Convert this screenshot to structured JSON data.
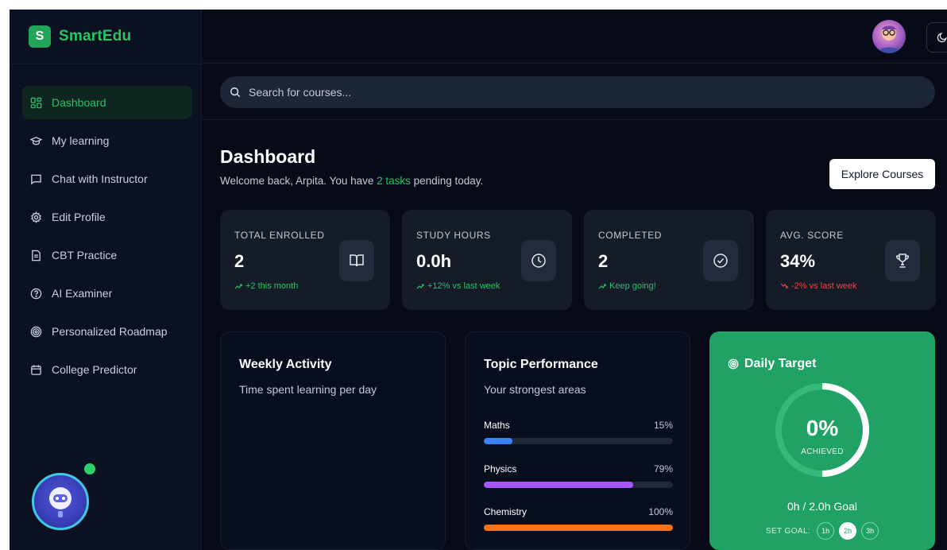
{
  "brand": {
    "logo_letter": "S",
    "name": "SmartEdu",
    "color": "#27c46a"
  },
  "sidebar": {
    "items": [
      {
        "label": "Dashboard",
        "icon": "dashboard-grid-icon",
        "active": true
      },
      {
        "label": "My learning",
        "icon": "graduation-cap-icon"
      },
      {
        "label": "Chat with Instructor",
        "icon": "chat-bubble-icon"
      },
      {
        "label": "Edit Profile",
        "icon": "gear-icon"
      },
      {
        "label": "CBT Practice",
        "icon": "document-icon"
      },
      {
        "label": "AI Examiner",
        "icon": "help-circle-icon"
      },
      {
        "label": "Personalized Roadmap",
        "icon": "target-icon"
      },
      {
        "label": "College Predictor",
        "icon": "calendar-icon"
      }
    ]
  },
  "search": {
    "placeholder": "Search for courses..."
  },
  "header": {
    "title": "Dashboard",
    "welcome_prefix": "Welcome back, Arpita. You have ",
    "welcome_highlight": "2 tasks",
    "welcome_suffix": " pending today.",
    "explore_label": "Explore Courses"
  },
  "stats": [
    {
      "label": "TOTAL ENROLLED",
      "value": "2",
      "trend": "+2 this month",
      "direction": "up",
      "icon": "book-open-icon"
    },
    {
      "label": "STUDY HOURS",
      "value": "0.0h",
      "trend": "+12% vs last week",
      "direction": "up",
      "icon": "clock-icon"
    },
    {
      "label": "COMPLETED",
      "value": "2",
      "trend": "Keep going!",
      "direction": "up",
      "icon": "check-circle-icon"
    },
    {
      "label": "AVG. SCORE",
      "value": "34%",
      "trend": "-2% vs last week",
      "direction": "down",
      "icon": "trophy-icon"
    }
  ],
  "weekly": {
    "title": "Weekly Activity",
    "subtitle": "Time spent learning per day"
  },
  "topics": {
    "title": "Topic Performance",
    "subtitle": "Your strongest areas",
    "items": [
      {
        "name": "Maths",
        "pct_label": "15%",
        "value": 15,
        "color": "#3b82f6"
      },
      {
        "name": "Physics",
        "pct_label": "79%",
        "value": 79,
        "color": "#a855f7"
      },
      {
        "name": "Chemistry",
        "pct_label": "100%",
        "value": 100,
        "color": "#f97316"
      }
    ]
  },
  "target": {
    "title": "Daily Target",
    "progress_label": "0%",
    "progress": 0,
    "achieved_label": "ACHIEVED",
    "goal_text": "0h / 2.0h Goal",
    "set_goal_label": "SET GOAL:",
    "options": [
      "1h",
      "2h",
      "3h"
    ],
    "selected": "2h"
  }
}
